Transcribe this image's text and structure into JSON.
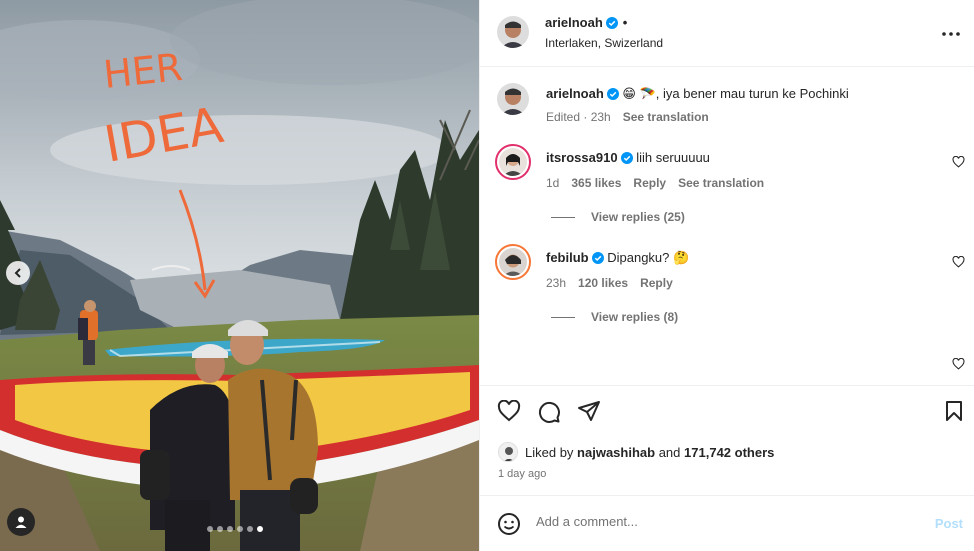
{
  "post": {
    "author": "arielnoah",
    "location": "Interlaken, Swizerland",
    "bullet": "•",
    "caption_emoji": "😁 🪂",
    "caption": ", iya bener mau turun ke Pochinki",
    "edited": "Edited",
    "age": "23h",
    "see_translation": "See translation"
  },
  "photo": {
    "handwriting_1": "HER",
    "handwriting_2": "IDEA",
    "slides": 6,
    "active_slide": 6
  },
  "comments": [
    {
      "user": "itsrossa910",
      "text": "liih seruuuuu",
      "age": "1d",
      "likes": "365 likes",
      "reply": "Reply",
      "translate": "See translation",
      "replies": "View replies (25)"
    },
    {
      "user": "febilub",
      "text": "Dipangku?",
      "emoji": "🤔",
      "age": "23h",
      "likes": "120 likes",
      "reply": "Reply",
      "replies": "View replies (8)"
    }
  ],
  "likes": {
    "prefix": "Liked by",
    "user": "najwashihab",
    "and": "and",
    "others": "171,742 others"
  },
  "date": "1 day ago",
  "add_comment": {
    "placeholder": "Add a comment...",
    "post": "Post"
  },
  "colors": {
    "verified": "#0095f6",
    "post_disabled": "#b2dffc",
    "muted": "#737373"
  }
}
